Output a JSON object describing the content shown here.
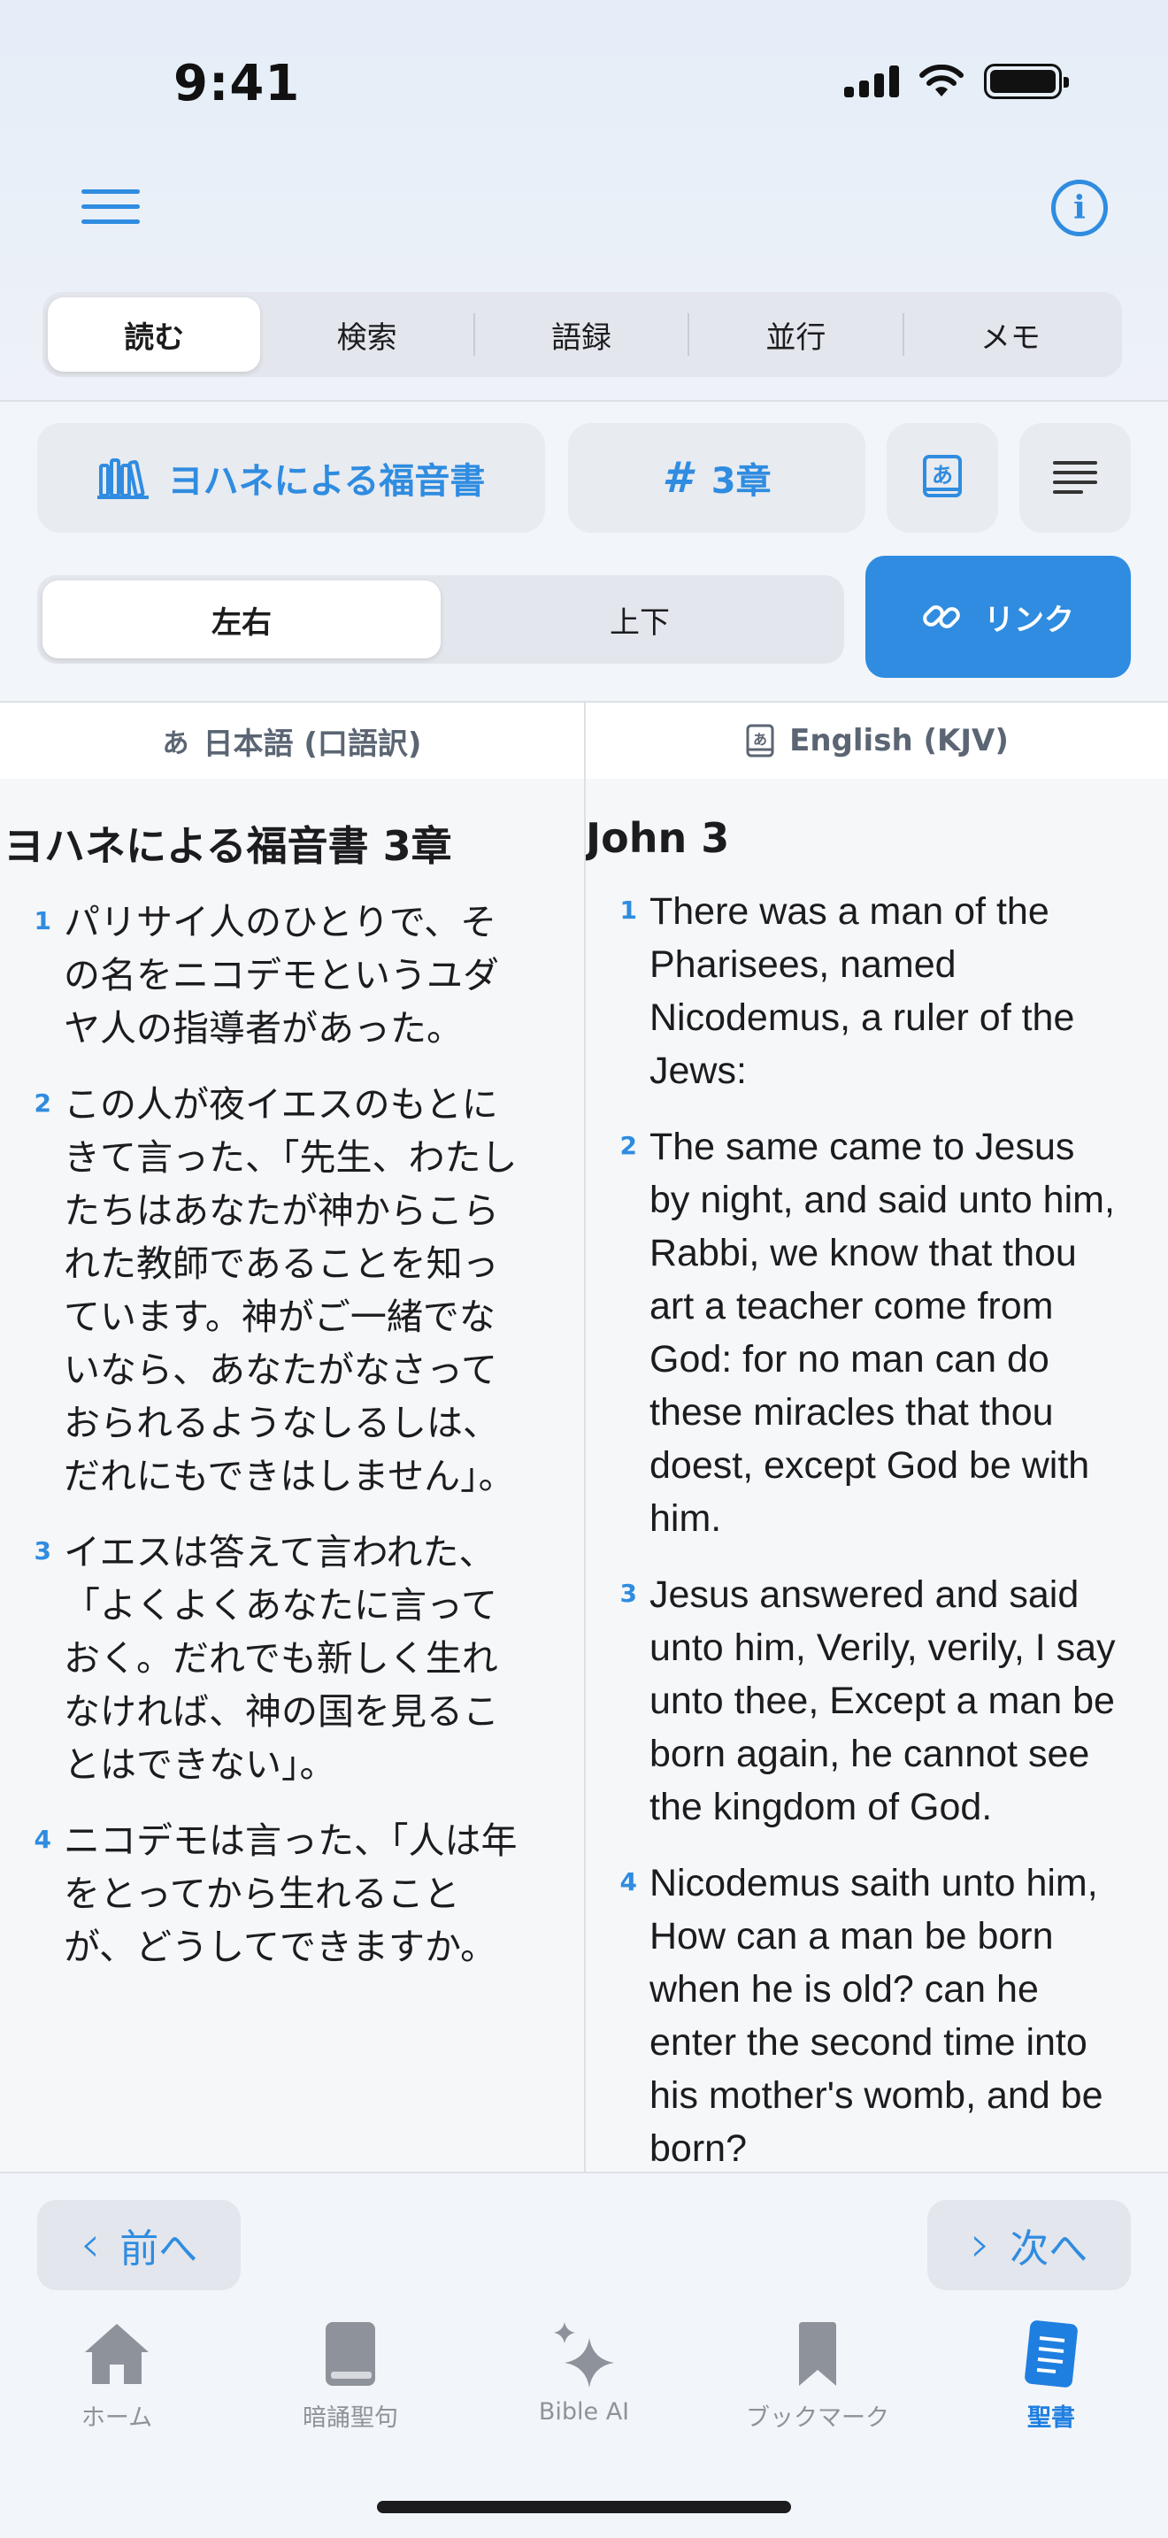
{
  "status": {
    "time": "9:41"
  },
  "modes": [
    "読む",
    "検索",
    "語録",
    "並行",
    "メモ"
  ],
  "book": {
    "name": "ヨハネによる福音書",
    "chapter": "3章",
    "lang_glyph": "あ"
  },
  "layout": {
    "left_right": "左右",
    "top_bottom": "上下",
    "link": "リンク"
  },
  "left": {
    "header": "日本語 (口語訳)",
    "header_glyph": "あ",
    "title": "ヨハネによる福音書 3章",
    "verses": [
      {
        "num": "1",
        "text": "パリサイ人のひとりで、その名をニコデモというユダヤ人の指導者があった。"
      },
      {
        "num": "2",
        "text": "この人が夜イエスのもとにきて言った、「先生、わたしたちはあなたが神からこられた教師であることを知っています。神がご一緒でないなら、あなたがなさっておられるようなしるしは、だれにもできはしません」。"
      },
      {
        "num": "3",
        "text": "イエスは答えて言われた、「よくよくあなたに言っておく。だれでも新しく生れなければ、神の国を見ることはできない」。"
      },
      {
        "num": "4",
        "text": "ニコデモは言った、「人は年をとってから生れることが、どうしてできますか。"
      }
    ]
  },
  "right": {
    "header": "English (KJV)",
    "title": "John 3",
    "verses": [
      {
        "num": "1",
        "text": "There was a man of the Pharisees, named Nicodemus, a ruler of the Jews:"
      },
      {
        "num": "2",
        "text": "The same came to Jesus by night, and said unto him, Rabbi, we know that thou art a teacher come from God: for no man can do these miracles that thou doest, except God be with him."
      },
      {
        "num": "3",
        "text": "Jesus answered and said unto him, Verily, verily, I say unto thee, Except a man be born again, he cannot see the kingdom of God."
      },
      {
        "num": "4",
        "text": "Nicodemus saith unto him, How can a man be born when he is old? can he enter the second time into his mother's womb, and be born?"
      }
    ]
  },
  "nav": {
    "prev": "前へ",
    "next": "次へ"
  },
  "tabs": [
    {
      "label": "ホーム",
      "icon": "home-icon"
    },
    {
      "label": "暗誦聖句",
      "icon": "book-icon"
    },
    {
      "label": "Bible AI",
      "icon": "sparkles-icon"
    },
    {
      "label": "ブックマーク",
      "icon": "bookmark-icon"
    },
    {
      "label": "聖書",
      "icon": "bible-icon"
    }
  ],
  "colors": {
    "accent": "#2f8ce0",
    "tab_active": "#1f7fe0"
  }
}
